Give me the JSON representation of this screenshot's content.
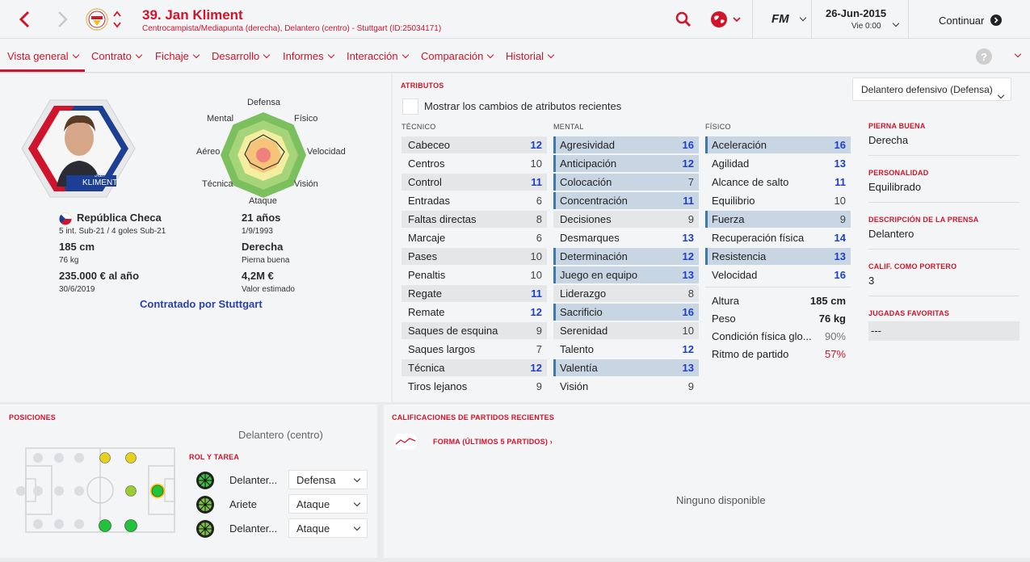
{
  "header": {
    "player_title": "39. Jan Kliment",
    "player_subtitle": "Centrocampista/Mediapunta (derecha), Delantero (centro) - Stuttgart (ID:25034171)",
    "fm_label": "FM",
    "date": "26-Jun-2015",
    "time": "Vie 0:00",
    "continue_label": "Continuar"
  },
  "nav": {
    "items": [
      "Vista general",
      "Contrato",
      "Fichaje",
      "Desarrollo",
      "Informes",
      "Interacción",
      "Comparación",
      "Historial"
    ]
  },
  "profile": {
    "card_first_name": "Jan",
    "card_last_name": "KLIMENT",
    "nationality": "República Checa",
    "caps": "5 int. Sub-21 / 4 goles Sub-21",
    "age": "21 años",
    "birth_date": "1/9/1993",
    "height": "185 cm",
    "weight": "76 kg",
    "foot": "Derecha",
    "foot_label": "Pierna buena",
    "wage": "235.000 € al año",
    "contract_end": "30/6/2019",
    "value": "4,2M €",
    "value_label": "Valor estimado",
    "signed_by": "Contratado por Stuttgart"
  },
  "radar": {
    "labels": {
      "defensa": "Defensa",
      "fisico": "Físico",
      "velocidad": "Velocidad",
      "vision": "Visión",
      "ataque": "Ataque",
      "tecnica": "Técnica",
      "aereo": "Aéreo",
      "mental": "Mental"
    }
  },
  "attributes": {
    "section_title": "ATRIBUTOS",
    "role_select": "Delantero defensivo (Defensa)",
    "show_changes_label": "Mostrar los cambios de atributos recientes",
    "technical_title": "TÉCNICO",
    "mental_title": "MENTAL",
    "physical_title": "FÍSICO",
    "technical": [
      {
        "name": "Cabeceo",
        "value": "12"
      },
      {
        "name": "Centros",
        "value": "10"
      },
      {
        "name": "Control",
        "value": "11"
      },
      {
        "name": "Entradas",
        "value": "6"
      },
      {
        "name": "Faltas directas",
        "value": "8"
      },
      {
        "name": "Marcaje",
        "value": "6"
      },
      {
        "name": "Pases",
        "value": "10"
      },
      {
        "name": "Penaltis",
        "value": "10"
      },
      {
        "name": "Regate",
        "value": "11"
      },
      {
        "name": "Remate",
        "value": "12"
      },
      {
        "name": "Saques de esquina",
        "value": "9"
      },
      {
        "name": "Saques largos",
        "value": "7"
      },
      {
        "name": "Técnica",
        "value": "12"
      },
      {
        "name": "Tiros lejanos",
        "value": "9"
      }
    ],
    "mental": [
      {
        "name": "Agresividad",
        "value": "16"
      },
      {
        "name": "Anticipación",
        "value": "12"
      },
      {
        "name": "Colocación",
        "value": "7"
      },
      {
        "name": "Concentración",
        "value": "11"
      },
      {
        "name": "Decisiones",
        "value": "9"
      },
      {
        "name": "Desmarques",
        "value": "13"
      },
      {
        "name": "Determinación",
        "value": "12"
      },
      {
        "name": "Juego en equipo",
        "value": "13"
      },
      {
        "name": "Liderazgo",
        "value": "8"
      },
      {
        "name": "Sacrificio",
        "value": "16"
      },
      {
        "name": "Serenidad",
        "value": "10"
      },
      {
        "name": "Talento",
        "value": "12"
      },
      {
        "name": "Valentía",
        "value": "13"
      },
      {
        "name": "Visión",
        "value": "9"
      }
    ],
    "physical": [
      {
        "name": "Aceleración",
        "value": "16"
      },
      {
        "name": "Agilidad",
        "value": "13"
      },
      {
        "name": "Alcance de salto",
        "value": "11"
      },
      {
        "name": "Equilibrio",
        "value": "10"
      },
      {
        "name": "Fuerza",
        "value": "9"
      },
      {
        "name": "Recuperación física",
        "value": "14"
      },
      {
        "name": "Resistencia",
        "value": "13"
      },
      {
        "name": "Velocidad",
        "value": "16"
      }
    ],
    "extra": [
      {
        "name": "Altura",
        "value": "185 cm"
      },
      {
        "name": "Peso",
        "value": "76 kg"
      },
      {
        "name": "Condición física glo...",
        "value": "90%"
      },
      {
        "name": "Ritmo de partido",
        "value": "57%"
      }
    ]
  },
  "side_info": {
    "foot_label": "PIERNA BUENA",
    "foot_value": "Derecha",
    "personality_label": "PERSONALIDAD",
    "personality_value": "Equilibrado",
    "press_label": "DESCRIPCIÓN DE LA PRENSA",
    "press_value": "Delantero",
    "gk_label": "CALIF. COMO PORTERO",
    "gk_value": "3",
    "moves_label": "JUGADAS FAVORITAS",
    "moves_value": "---"
  },
  "positions": {
    "title": "POSICIONES",
    "current": "Delantero (centro)",
    "role_title": "ROL Y TAREA",
    "roles": [
      {
        "role": "Delanter...",
        "duty": "Defensa"
      },
      {
        "role": "Ariete",
        "duty": "Ataque"
      },
      {
        "role": "Delanter...",
        "duty": "Ataque"
      }
    ]
  },
  "ratings": {
    "title": "CALIFICACIONES DE PARTIDOS RECIENTES",
    "form_label": "FORMA (ÚLTIMOS 5 PARTIDOS) ›",
    "empty_label": "Ninguno disponible"
  },
  "colors": {
    "accent": "#d0142b",
    "highlight": "#c8d5e2",
    "value_blue": "#1e40c8"
  }
}
